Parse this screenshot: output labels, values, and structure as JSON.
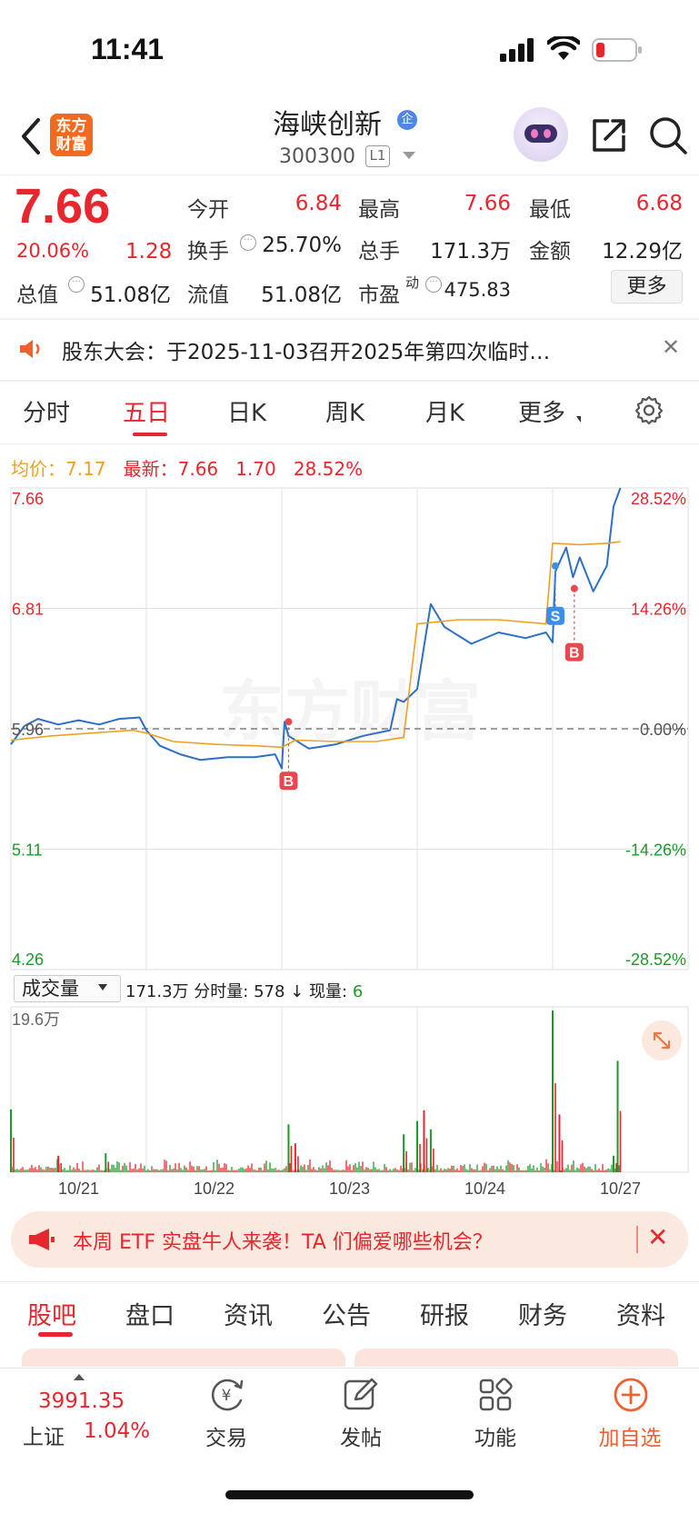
{
  "status_bar": {
    "time": "11:41"
  },
  "header": {
    "logo_line1": "东方",
    "logo_line2": "财富",
    "stock_name": "海峡创新",
    "badge": "企",
    "stock_code": "300300",
    "level": "L1"
  },
  "quote": {
    "price": "7.66",
    "pct_change": "20.06%",
    "abs_change": "1.28",
    "rows": [
      [
        {
          "label": "今开",
          "value": "6.84",
          "color": "red"
        },
        {
          "label": "最高",
          "value": "7.66",
          "color": "red"
        },
        {
          "label": "最低",
          "value": "6.68",
          "color": "red"
        }
      ],
      [
        {
          "label": "换手",
          "value": "25.70%",
          "color": "black"
        },
        {
          "label": "总手",
          "value": "171.3万",
          "color": "black"
        },
        {
          "label": "金额",
          "value": "12.29亿",
          "color": "black"
        }
      ],
      [
        {
          "label": "总值",
          "value": "51.08亿",
          "color": "black"
        },
        {
          "label": "流值",
          "value": "51.08亿",
          "color": "black"
        },
        {
          "label": "市盈",
          "value": "475.83",
          "color": "black"
        }
      ]
    ],
    "pe_superscript": "动",
    "more_label": "更多"
  },
  "notice": {
    "text": "股东大会：于2025-11-03召开2025年第四次临时…"
  },
  "chart_tabs": [
    "分时",
    "五日",
    "日K",
    "周K",
    "月K",
    "更多"
  ],
  "chart_tabs_active": 1,
  "chart_legend": {
    "avg_label": "均价：",
    "avg_value": "7.17",
    "latest_label": "最新：",
    "latest_price": "7.66",
    "latest_change": "1.70",
    "latest_pct": "28.52%"
  },
  "chart_data": {
    "type": "line",
    "title": "",
    "x_labels": [
      "10/21",
      "10/22",
      "10/23",
      "10/24",
      "10/27"
    ],
    "y_left_ticks": [
      "7.66",
      "6.81",
      "5.96",
      "5.11",
      "4.26"
    ],
    "y_right_ticks": [
      "28.52%",
      "14.26%",
      "0.00%",
      "-14.26%",
      "-28.52%"
    ],
    "ylim": [
      4.26,
      7.66
    ],
    "reference_price": 5.96,
    "series": [
      {
        "color": "#2d6fc4",
        "x": [
          0,
          0.1,
          0.2,
          0.35,
          0.5,
          0.65,
          0.8,
          0.95,
          1.0,
          1.1,
          1.25,
          1.4,
          1.6,
          1.8,
          1.95,
          2.0,
          2.02,
          2.05,
          2.2,
          2.4,
          2.6,
          2.8,
          2.85,
          2.9,
          3.0,
          3.1,
          3.2,
          3.4,
          3.6,
          3.8,
          3.95,
          4.0,
          4.02,
          4.1,
          4.15,
          4.2,
          4.3,
          4.4,
          4.45,
          4.5
        ],
        "y": [
          5.85,
          5.98,
          6.03,
          5.99,
          6.02,
          5.99,
          6.03,
          6.04,
          5.95,
          5.84,
          5.78,
          5.74,
          5.76,
          5.76,
          5.78,
          5.68,
          6.01,
          5.91,
          5.82,
          5.85,
          5.91,
          5.95,
          6.17,
          6.15,
          6.24,
          6.84,
          6.68,
          6.56,
          6.64,
          6.6,
          6.64,
          6.57,
          7.07,
          7.24,
          7.03,
          7.17,
          6.93,
          7.11,
          7.53,
          7.66
        ]
      },
      {
        "color": "#f0a020",
        "x": [
          0,
          0.3,
          0.6,
          0.9,
          1.0,
          1.2,
          1.5,
          1.8,
          2.0,
          2.1,
          2.4,
          2.7,
          2.9,
          3.0,
          3.3,
          3.6,
          3.95,
          4.0,
          4.2,
          4.4,
          4.5
        ],
        "y": [
          5.88,
          5.91,
          5.93,
          5.95,
          5.93,
          5.87,
          5.85,
          5.84,
          5.83,
          5.88,
          5.87,
          5.87,
          5.9,
          6.7,
          6.73,
          6.73,
          6.7,
          7.27,
          7.26,
          7.27,
          7.28
        ]
      }
    ],
    "markers": [
      {
        "label": "B",
        "x": 2.05,
        "y": 6.01,
        "color": "#e8474d"
      },
      {
        "label": "S",
        "x": 4.02,
        "y": 7.11,
        "color": "#3b8fe8"
      },
      {
        "label": "B",
        "x": 4.16,
        "y": 6.95,
        "color": "#e8474d"
      }
    ],
    "watermark": "东方财富",
    "volume": {
      "max_label": "19.6万",
      "max_value": 196000,
      "spikes": [
        {
          "x": 0.0,
          "v": 76000
        },
        {
          "x": 0.35,
          "v": 20000
        },
        {
          "x": 0.7,
          "v": 23000
        },
        {
          "x": 2.05,
          "v": 58000
        },
        {
          "x": 2.1,
          "v": 35000
        },
        {
          "x": 2.9,
          "v": 46000
        },
        {
          "x": 3.0,
          "v": 62000
        },
        {
          "x": 3.05,
          "v": 75000
        },
        {
          "x": 3.1,
          "v": 52000
        },
        {
          "x": 4.0,
          "v": 196000
        },
        {
          "x": 4.05,
          "v": 70000
        },
        {
          "x": 4.45,
          "v": 20000
        },
        {
          "x": 4.48,
          "v": 135000
        }
      ]
    }
  },
  "volume_header": {
    "selector": "成交量",
    "total": "171.3万",
    "bar_label": "分时量:",
    "bar_value": "578",
    "arrow": "↓",
    "now_label": "现量:",
    "now_value": "6"
  },
  "promo": {
    "text": "本周 ETF 实盘牛人来袭！TA 们偏爱哪些机会？"
  },
  "bottom_tabs": [
    "股吧",
    "盘口",
    "资讯",
    "公告",
    "研报",
    "财务",
    "资料"
  ],
  "bottom_nav": {
    "index_value": "3991.35",
    "index_name": "上证",
    "index_pct": "1.04%",
    "items": [
      "交易",
      "发帖",
      "功能",
      "加自选"
    ]
  }
}
